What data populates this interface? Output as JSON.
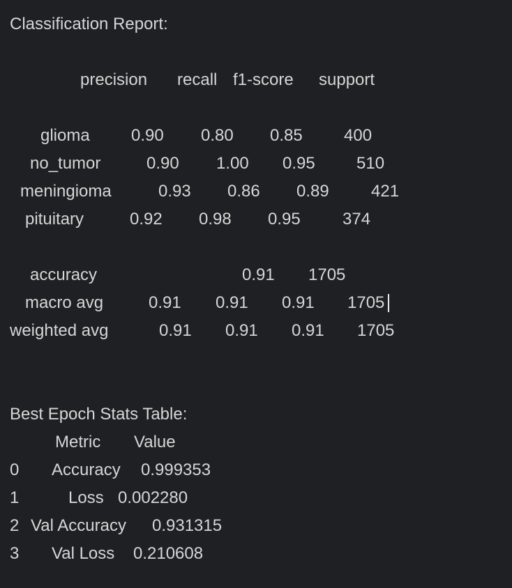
{
  "classification_report": {
    "heading": "Classification Report:",
    "columns": [
      "precision",
      "recall",
      "f1-score",
      "support"
    ],
    "rows": [
      {
        "label": "glioma",
        "precision": "0.90",
        "recall": "0.80",
        "f1": "0.85",
        "support": "400"
      },
      {
        "label": "no_tumor",
        "precision": "0.90",
        "recall": "1.00",
        "f1": "0.95",
        "support": "510"
      },
      {
        "label": "meningioma",
        "precision": "0.93",
        "recall": "0.86",
        "f1": "0.89",
        "support": "421"
      },
      {
        "label": "pituitary",
        "precision": "0.92",
        "recall": "0.98",
        "f1": "0.95",
        "support": "374"
      }
    ],
    "accuracy": {
      "label": "accuracy",
      "f1": "0.91",
      "support": "1705"
    },
    "macro_avg": {
      "label": "macro avg",
      "precision": "0.91",
      "recall": "0.91",
      "f1": "0.91",
      "support": "1705"
    },
    "weighted_avg": {
      "label": "weighted avg",
      "precision": "0.91",
      "recall": "0.91",
      "f1": "0.91",
      "support": "1705"
    }
  },
  "best_epoch": {
    "heading": "Best Epoch Stats Table:",
    "columns": [
      "Metric",
      "Value"
    ],
    "rows": [
      {
        "index": "0",
        "metric": "Accuracy",
        "value": "0.999353"
      },
      {
        "index": "1",
        "metric": "Loss",
        "value": "0.002280"
      },
      {
        "index": "2",
        "metric": "Val Accuracy",
        "value": "0.931315"
      },
      {
        "index": "3",
        "metric": "Val Loss",
        "value": "0.210608"
      }
    ]
  }
}
